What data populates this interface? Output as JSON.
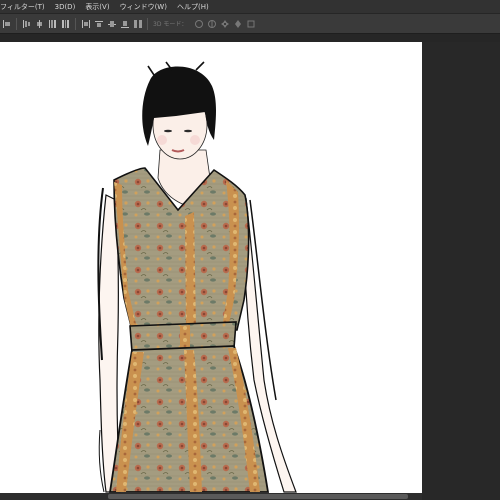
{
  "menubar": {
    "items": [
      {
        "label": "フィルター(T)"
      },
      {
        "label": "3D(D)"
      },
      {
        "label": "表示(V)"
      },
      {
        "label": "ウィンドウ(W)"
      },
      {
        "label": "ヘルプ(H)"
      }
    ]
  },
  "options_bar": {
    "mode_3d_label": "3D モード：",
    "align_icons": [
      "align-left-edges-icon",
      "align-horizontal-centers-icon",
      "align-right-edges-icon",
      "distribute-top-icon",
      "distribute-vertical-centers-icon",
      "distribute-bottom-icon",
      "distribute-left-icon",
      "distribute-horizontal-centers-icon",
      "distribute-right-icon",
      "auto-align-icon"
    ],
    "mode_3d_icons": [
      "rotate-3d-icon",
      "roll-3d-icon",
      "pan-3d-icon",
      "slide-3d-icon",
      "scale-3d-icon"
    ]
  },
  "canvas": {
    "artwork": "fashion-illustration"
  },
  "colors": {
    "menubar_bg": "#323232",
    "options_bg": "#3a3a3a",
    "canvas_bg": "#ffffff",
    "panel_bg": "#282828",
    "dress_fabric": "#a49c80",
    "dress_stripe": "#c9914f",
    "skin": "#fbefe8",
    "hair": "#111111"
  }
}
